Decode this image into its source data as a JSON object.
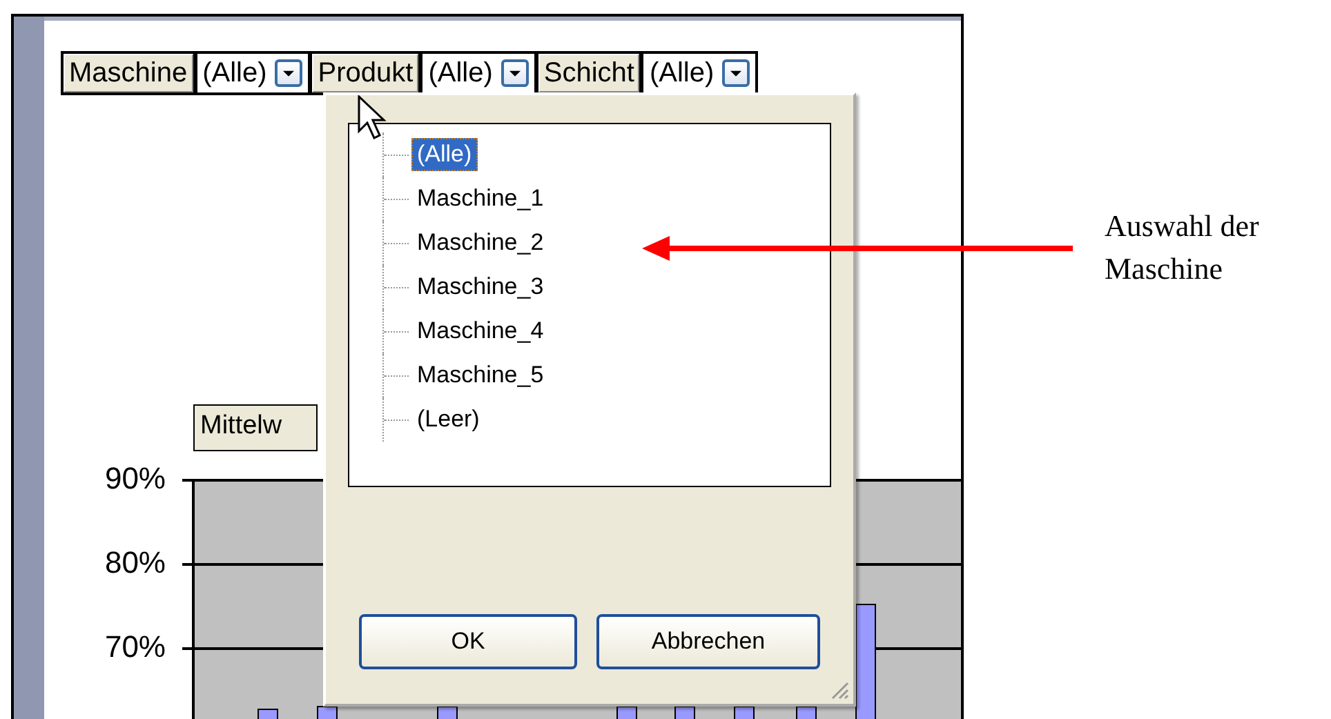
{
  "filters": [
    {
      "label": "Maschine",
      "value": "(Alle)"
    },
    {
      "label": "Produkt",
      "value": "(Alle)"
    },
    {
      "label": "Schicht",
      "value": "(Alle)"
    }
  ],
  "dropdown": {
    "items": [
      {
        "label": "(Alle)",
        "selected": true
      },
      {
        "label": "Maschine_1",
        "selected": false
      },
      {
        "label": "Maschine_2",
        "selected": false
      },
      {
        "label": "Maschine_3",
        "selected": false
      },
      {
        "label": "Maschine_4",
        "selected": false
      },
      {
        "label": "Maschine_5",
        "selected": false
      },
      {
        "label": "(Leer)",
        "selected": false
      }
    ],
    "buttons": [
      "OK",
      "Abbrechen"
    ]
  },
  "chart": {
    "series_button": "Mittelw",
    "y_axis_labels": [
      "90%",
      "80%",
      "70%"
    ]
  },
  "annotation": {
    "text": "Auswahl der Maschine"
  }
}
